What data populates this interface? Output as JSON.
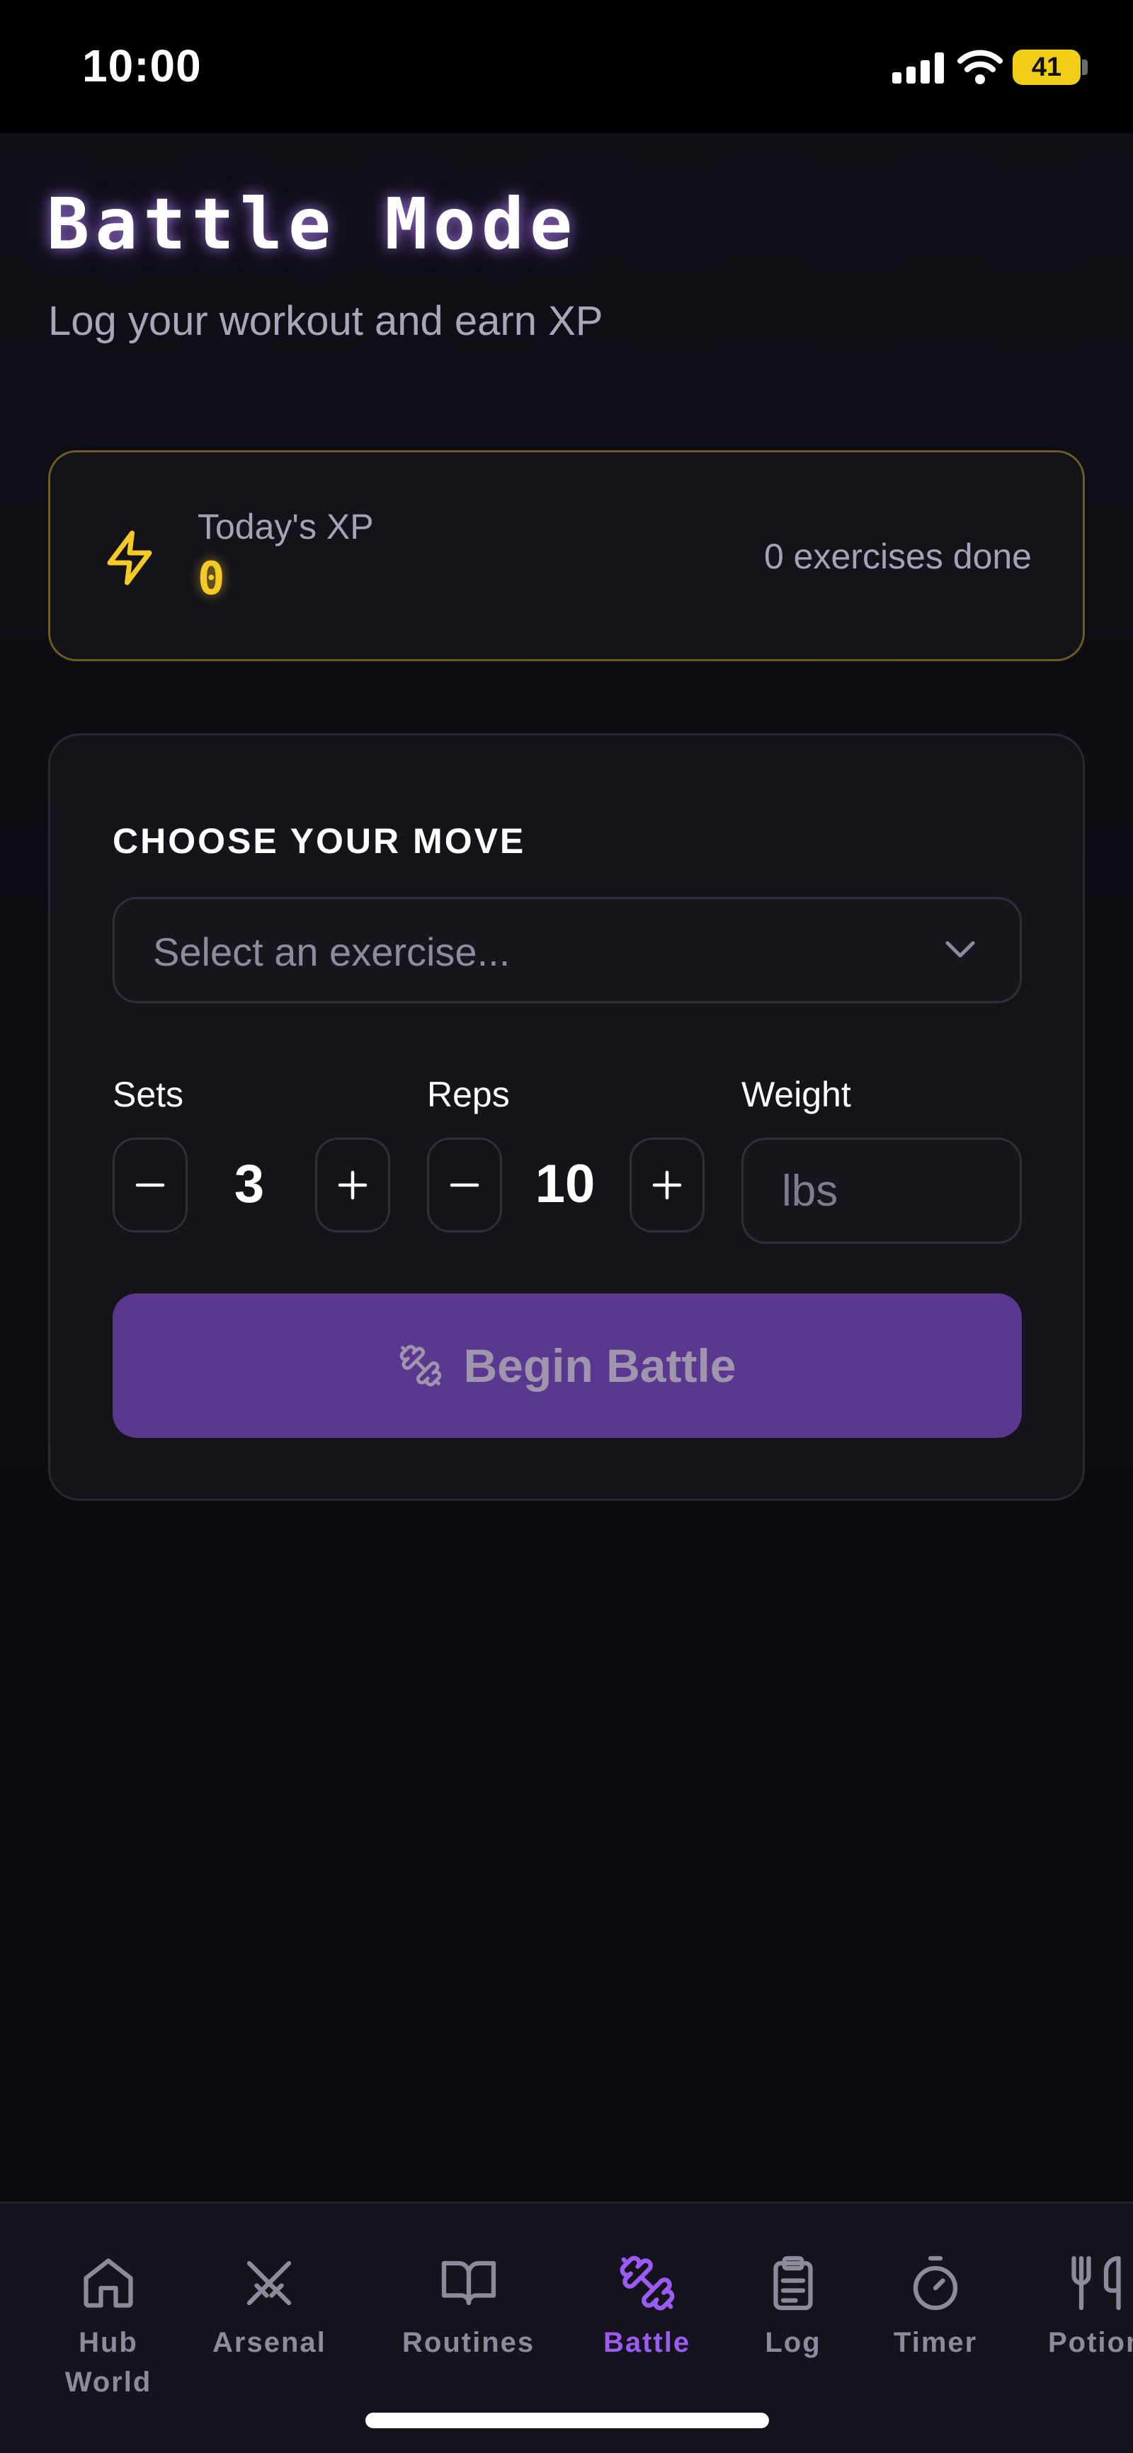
{
  "status_bar": {
    "time": "10:00",
    "battery": "41"
  },
  "header": {
    "title": "Battle Mode",
    "subtitle": "Log your workout and earn XP"
  },
  "xp_card": {
    "label": "Today's XP",
    "value": "0",
    "exercises_done": "0 exercises done",
    "icon": "lightning-icon",
    "accent_color": "#f5c926"
  },
  "move_card": {
    "heading": "CHOOSE YOUR MOVE",
    "exercise_select": {
      "placeholder": "Select an exercise..."
    },
    "sets": {
      "label": "Sets",
      "value": "3"
    },
    "reps": {
      "label": "Reps",
      "value": "10"
    },
    "weight": {
      "label": "Weight",
      "placeholder": "lbs"
    },
    "begin_button": {
      "label": "Begin Battle",
      "icon": "dumbbell-icon",
      "color": "#5a3890"
    }
  },
  "bottom_nav": {
    "active_color": "#9b5cf6",
    "items": [
      {
        "label": "Hub World",
        "icon": "home-icon"
      },
      {
        "label": "Arsenal",
        "icon": "crossed-swords-icon"
      },
      {
        "label": "Routines",
        "icon": "book-icon"
      },
      {
        "label": "Battle",
        "icon": "dumbbell-icon",
        "active": true
      },
      {
        "label": "Log",
        "icon": "clipboard-icon"
      },
      {
        "label": "Timer",
        "icon": "stopwatch-icon"
      },
      {
        "label": "Potion",
        "icon": "fork-knife-icon"
      }
    ]
  }
}
